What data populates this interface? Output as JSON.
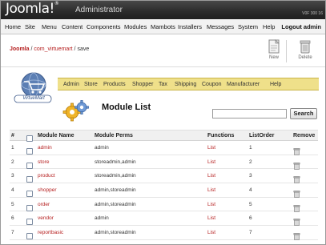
{
  "header": {
    "logo_text": "Joomla!",
    "logo_mark": "®",
    "admin_label": "Administrator",
    "version": "V0F 300 16"
  },
  "menu": {
    "items": [
      "Home",
      "Site",
      "Menu",
      "Content",
      "Components",
      "Modules",
      "Mambots",
      "Installers",
      "Messages",
      "System",
      "Help"
    ],
    "logout": "Logout admin"
  },
  "breadcrumb": {
    "site": "Joomla",
    "sep1": " / ",
    "component": "com_virtuemart",
    "sep2": " / ",
    "task": "save"
  },
  "toolbar": {
    "new_label": "New",
    "delete_label": "Delete"
  },
  "vm": {
    "logo_text": "VirtueMart",
    "nav": [
      "Admin",
      "Store",
      "Products",
      "Shopper",
      "Tax",
      "Shipping",
      "Coupon",
      "Manufacturer",
      "Help"
    ]
  },
  "page": {
    "title": "Module List"
  },
  "search": {
    "value": "",
    "button": "Search"
  },
  "table": {
    "headers": {
      "num": "#",
      "name": "Module Name",
      "perms": "Module Perms",
      "functions": "Functions",
      "order": "ListOrder",
      "remove": "Remove"
    },
    "rows": [
      {
        "num": "1",
        "name": "admin",
        "perms": "admin",
        "func": "List",
        "order": "1"
      },
      {
        "num": "2",
        "name": "store",
        "perms": "storeadmin,admin",
        "func": "List",
        "order": "2"
      },
      {
        "num": "3",
        "name": "product",
        "perms": "storeadmin,admin",
        "func": "List",
        "order": "3"
      },
      {
        "num": "4",
        "name": "shopper",
        "perms": "admin,storeadmin",
        "func": "List",
        "order": "4"
      },
      {
        "num": "5",
        "name": "order",
        "perms": "admin,storeadmin",
        "func": "List",
        "order": "5"
      },
      {
        "num": "6",
        "name": "vendor",
        "perms": "admin",
        "func": "List",
        "order": "6"
      },
      {
        "num": "7",
        "name": "reportbasic",
        "perms": "admin,storeadmin",
        "func": "List",
        "order": "7"
      }
    ]
  },
  "colors": {
    "link_red": "#b51e1e",
    "vm_bar": "#efe08a",
    "topbar": "#2b2b2b"
  },
  "icons": {
    "new": "new-document-icon",
    "delete": "delete-trash-icon",
    "remove": "trash-icon",
    "gears": "gears-icon"
  }
}
